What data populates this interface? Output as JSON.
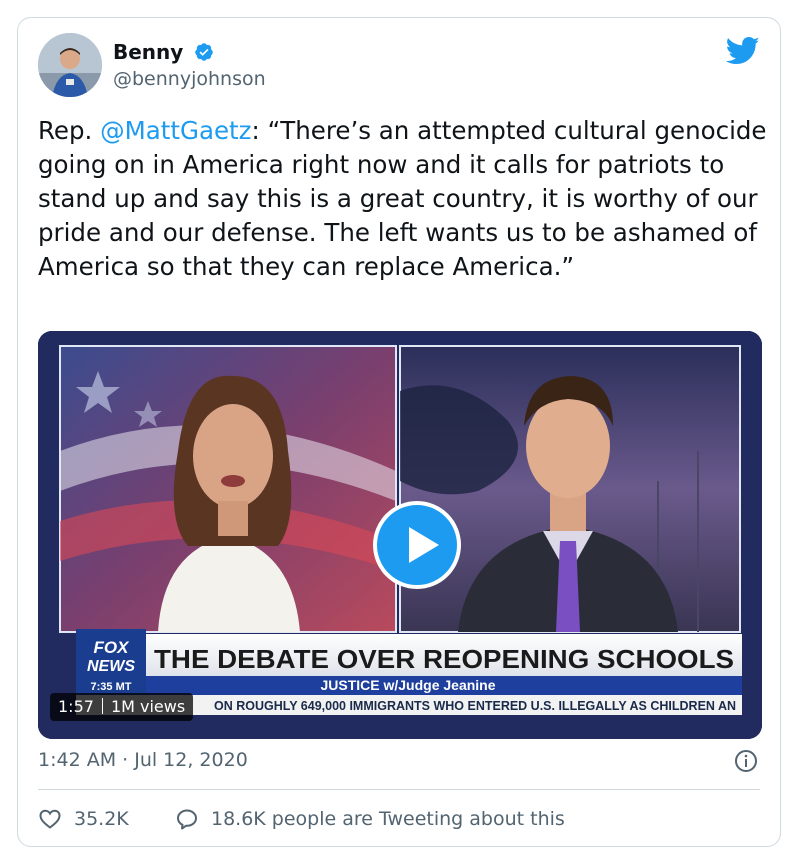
{
  "tweet": {
    "author_name": "Benny",
    "author_handle": "@bennyjohnson",
    "text_prefix": "Rep. ",
    "mention": "@MattGaetz",
    "text_body": ": “There’s an attempted cultural genocide going on in America right now and it calls for patriots to stand up and say this is a great country, it is worthy of our pride and our defense. The left wants us to be ashamed of America so that they can replace America.”",
    "timestamp": "1:42 AM · Jul 12, 2020",
    "likes": "35.2K",
    "conversation": "18.6K people are Tweeting about this"
  },
  "video": {
    "duration": "1:57",
    "views": "1M views",
    "chyron_logo_top": "FOX",
    "chyron_logo_bottom": "NEWS",
    "chyron_headline": "THE DEBATE OVER REOPENING SCHOOLS",
    "chyron_show": "JUSTICE w/Judge Jeanine",
    "chyron_time": "7:35 MT",
    "chyron_ticker": "ON ROUGHLY 649,000 IMMIGRANTS WHO ENTERED U.S. ILLEGALLY AS CHILDREN AN"
  },
  "icons": {
    "verified": "verified-badge-icon",
    "twitter": "twitter-bird-icon",
    "play": "play-icon",
    "info": "info-icon",
    "like": "heart-icon",
    "reply": "speech-bubble-icon"
  },
  "colors": {
    "accent": "#1d9bf0",
    "secondary_text": "#536471",
    "border": "#cfd9de"
  }
}
